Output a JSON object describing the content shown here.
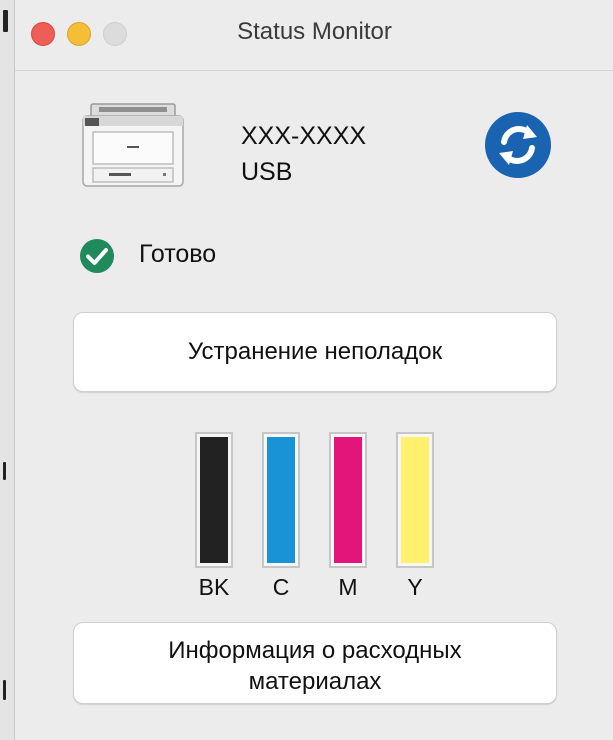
{
  "window": {
    "title": "Status Monitor"
  },
  "device": {
    "name": "XXX-XXXX",
    "connection": "USB"
  },
  "status": {
    "text": "Готово",
    "color": "#1f8a5a"
  },
  "buttons": {
    "troubleshoot": "Устранение неполадок",
    "supplies_line1": "Информация о расходных",
    "supplies_line2": "материалах"
  },
  "inks": [
    {
      "label": "BK",
      "color": "#222222",
      "level": 1.0
    },
    {
      "label": "C",
      "color": "#1a93d6",
      "level": 1.0
    },
    {
      "label": "M",
      "color": "#e4157a",
      "level": 1.0
    },
    {
      "label": "Y",
      "color": "#fff06e",
      "level": 1.0
    }
  ],
  "icons": {
    "refresh": "refresh-icon",
    "status": "check-circle-icon",
    "printer": "printer-icon"
  },
  "colors": {
    "accent": "#1a63b0",
    "close": "#ee5e56",
    "minimize": "#f5be37",
    "zoom": "#dcdcdc"
  }
}
